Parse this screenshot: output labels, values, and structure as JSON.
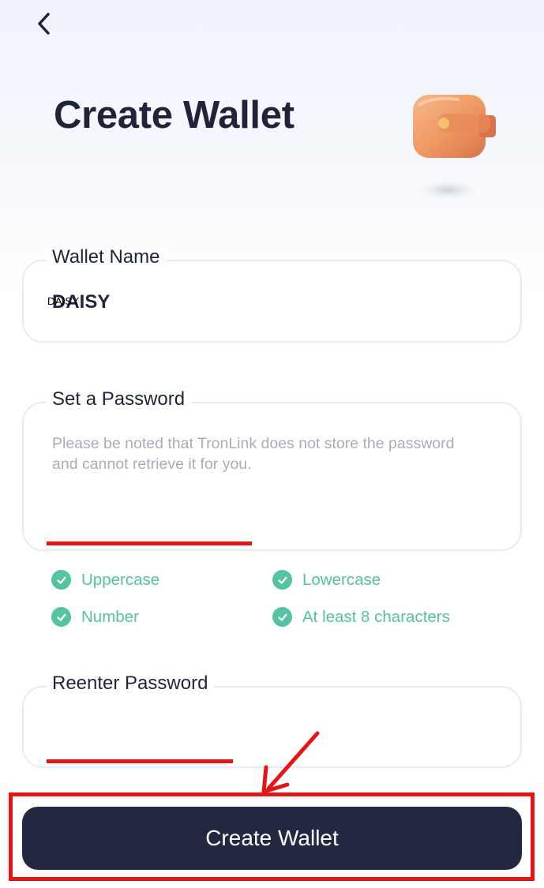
{
  "header": {
    "title": "Create Wallet",
    "back_icon": "chevron-left-icon",
    "illustration_icon": "wallet-icon"
  },
  "wallet_name": {
    "label": "Wallet Name",
    "value": "DAISY"
  },
  "password": {
    "label": "Set a Password",
    "placeholder": "Please be noted that TronLink does not store the password and cannot retrieve it for you.",
    "value": ""
  },
  "password_rules": [
    {
      "label": "Uppercase",
      "met": true
    },
    {
      "label": "Lowercase",
      "met": true
    },
    {
      "label": "Number",
      "met": true
    },
    {
      "label": "At least 8 characters",
      "met": true
    }
  ],
  "reenter_password": {
    "label": "Reenter Password",
    "value": ""
  },
  "submit": {
    "label": "Create Wallet"
  },
  "colors": {
    "primary_dark": "#232840",
    "success": "#54c2a3",
    "annotation_red": "#e41515",
    "placeholder_gray": "#a7adbb"
  }
}
